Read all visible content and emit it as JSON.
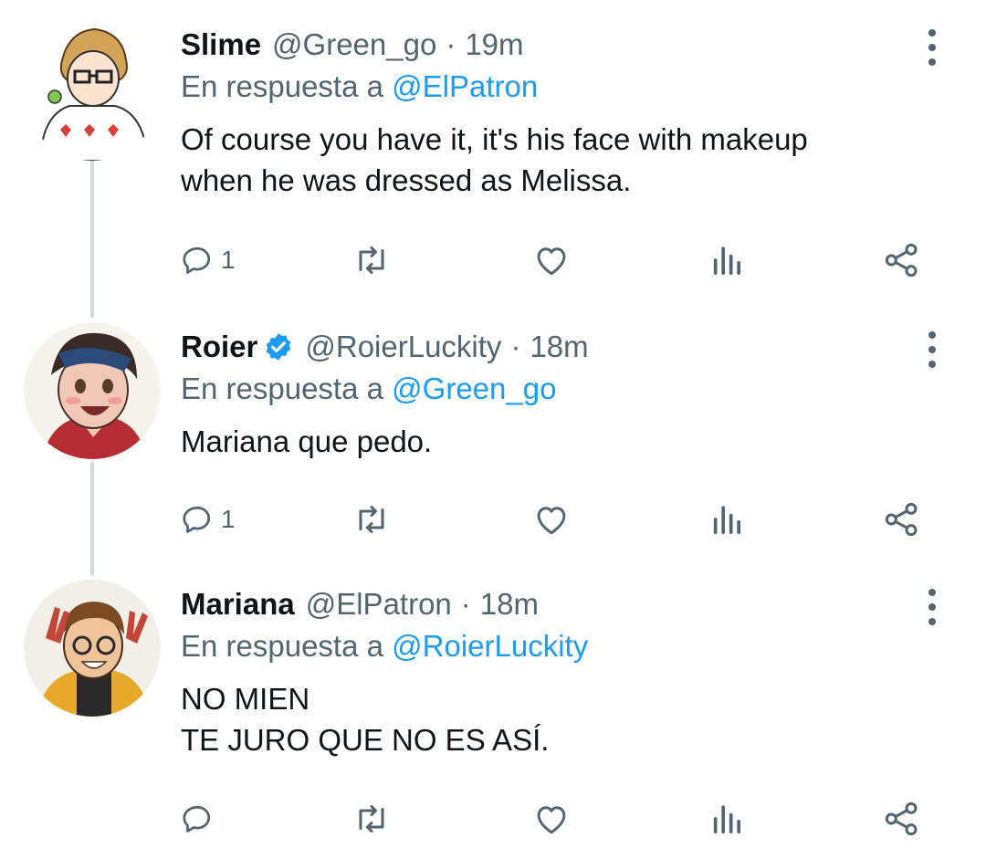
{
  "tweets": [
    {
      "name": "Slime",
      "handle": "@Green_go",
      "dot": "·",
      "time": "19m",
      "verified": false,
      "reply_prefix": "En respuesta a",
      "reply_to": "@ElPatron",
      "text": "Of course you have it, it's his face with makeup\nwhen he was dressed as Melissa.",
      "reply_count": "1"
    },
    {
      "name": "Roier",
      "handle": "@RoierLuckity",
      "dot": "·",
      "time": "18m",
      "verified": true,
      "reply_prefix": "En respuesta a",
      "reply_to": "@Green_go",
      "text": "Mariana que pedo.",
      "reply_count": "1"
    },
    {
      "name": "Mariana",
      "handle": "@ElPatron",
      "dot": "·",
      "time": "18m",
      "verified": false,
      "reply_prefix": "En respuesta a",
      "reply_to": "@RoierLuckity",
      "text": "NO MIEN\nTE JURO QUE NO ES ASÍ.",
      "reply_count": ""
    }
  ],
  "colors": {
    "text_primary": "#0f1419",
    "text_secondary": "#536471",
    "accent": "#1d9bf0",
    "thread_line": "#cfd9de"
  },
  "icons": [
    "reply-icon",
    "retweet-icon",
    "like-icon",
    "analytics-icon",
    "share-icon",
    "more-icon",
    "verified-badge-icon"
  ]
}
